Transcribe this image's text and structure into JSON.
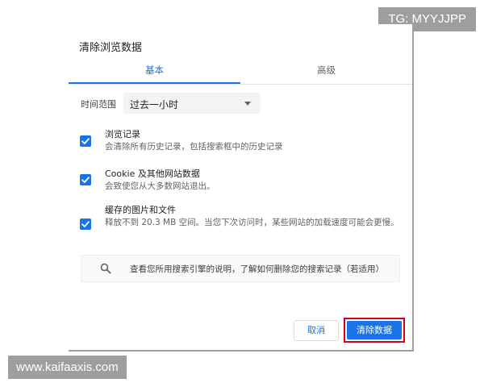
{
  "watermarks": {
    "top": "TG: MYYJJPP",
    "bottom": "www.kaifaaxis.com"
  },
  "dialog": {
    "title": "清除浏览数据",
    "tabs": [
      {
        "label": "基本",
        "active": true
      },
      {
        "label": "高级",
        "active": false
      }
    ],
    "time_range": {
      "label": "时间范围",
      "value": "过去一小时"
    },
    "options": [
      {
        "title": "浏览记录",
        "description": "会清除所有历史记录，包括搜索框中的历史记录",
        "checked": true
      },
      {
        "title": "Cookie 及其他网站数据",
        "description": "会致使您从大多数网站退出。",
        "checked": true
      },
      {
        "title": "缓存的图片和文件",
        "description": "释放不到 20.3 MB 空间。当您下次访问时，某些网站的加载速度可能会更慢。",
        "checked": true
      }
    ],
    "search_hint": {
      "icon": "search-icon",
      "text": "查看您所用搜索引擎的说明，了解如何删除您的搜索记录（若适用）"
    },
    "buttons": {
      "cancel": "取消",
      "clear": "清除数据"
    }
  },
  "colors": {
    "accent": "#1a73e8",
    "highlight_border": "#d0021b",
    "watermark_bg": "#9e9e9e"
  }
}
